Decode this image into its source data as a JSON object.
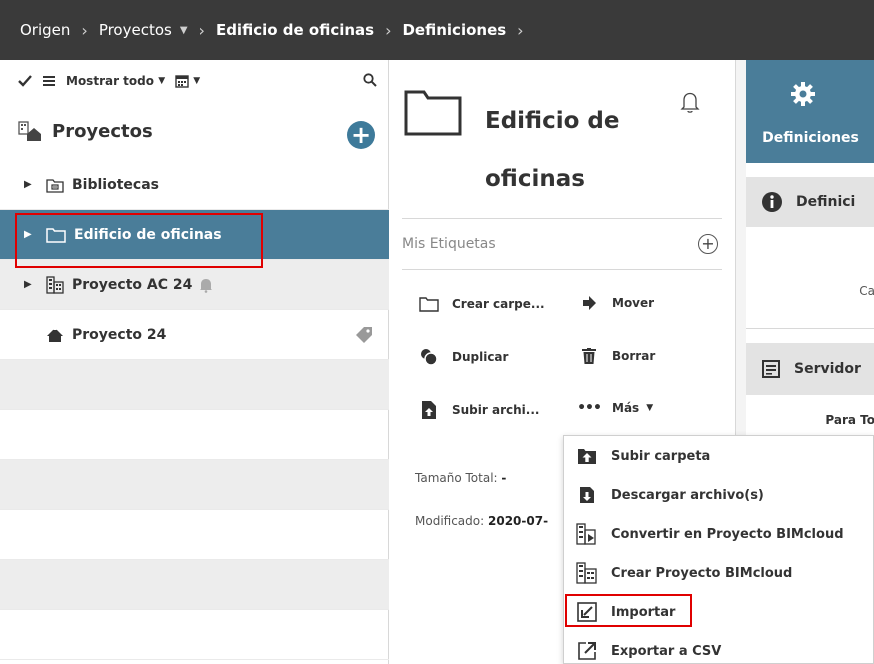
{
  "breadcrumb": {
    "items": [
      {
        "label": "Origen",
        "bold": false
      },
      {
        "label": "Proyectos",
        "bold": false,
        "caret": "▼"
      },
      {
        "label": "Edificio de oficinas",
        "bold": true
      },
      {
        "label": "Definiciones",
        "bold": true
      }
    ],
    "separator": "›"
  },
  "toolbar": {
    "show_all_label": "Mostrar todo"
  },
  "sidebar": {
    "title": "Proyectos",
    "items": [
      {
        "label": "Bibliotecas",
        "icon": "library-icon"
      },
      {
        "label": "Edificio de oficinas",
        "icon": "folder-icon",
        "selected": true
      },
      {
        "label": "Proyecto AC 24",
        "icon": "building-icon",
        "bell": true
      },
      {
        "label": "Proyecto 24",
        "icon": "house-icon",
        "tag": true
      }
    ]
  },
  "detail": {
    "title": "Edificio de oficinas",
    "tags_placeholder": "Mis Etiquetas",
    "actions": {
      "create_folder": "Crear carpe...",
      "move": "Mover",
      "duplicate": "Duplicar",
      "delete": "Borrar",
      "upload": "Subir archi...",
      "more": "Más"
    },
    "total_size_label": "Tamaño Total:",
    "total_size_value": "-",
    "modified_label": "Modificado:",
    "modified_value": "2020-07-"
  },
  "right_panel": {
    "tab_label": "Definiciones",
    "section_info": "Definici",
    "ca_text": "Ca",
    "section_server": "Servidor",
    "para_text": "Para To"
  },
  "dropdown": {
    "items": [
      {
        "label": "Subir carpeta",
        "icon": "upload-folder-icon"
      },
      {
        "label": "Descargar archivo(s)",
        "icon": "download-icon"
      },
      {
        "label": "Convertir en Proyecto BIMcloud",
        "icon": "convert-project-icon"
      },
      {
        "label": "Crear Proyecto BIMcloud",
        "icon": "create-project-icon"
      },
      {
        "label": "Importar",
        "icon": "import-icon"
      },
      {
        "label": "Exportar a CSV",
        "icon": "export-icon"
      }
    ]
  },
  "colors": {
    "topbar": "#3a3a3a",
    "accent": "#4a7d99",
    "highlight_outline": "#e00000"
  }
}
